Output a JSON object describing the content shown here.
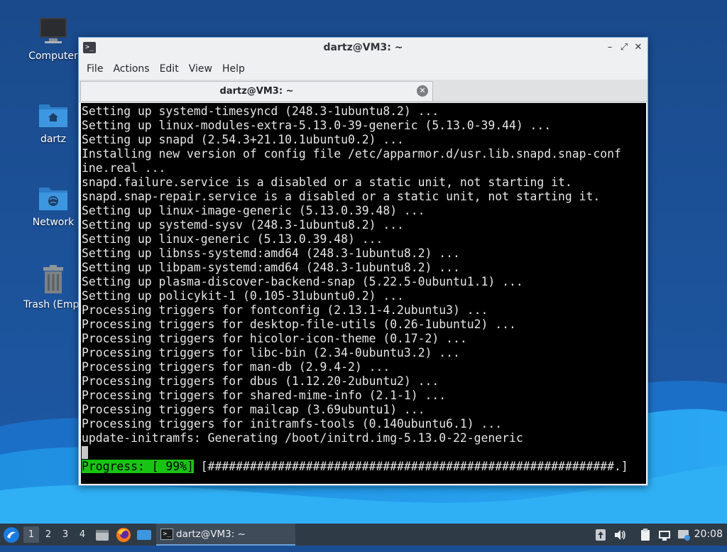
{
  "desktop": {
    "icons": [
      {
        "label": "Computer",
        "icon": "computer-icon"
      },
      {
        "label": "dartz",
        "icon": "home-folder-icon"
      },
      {
        "label": "Network",
        "icon": "network-folder-icon"
      },
      {
        "label": "Trash (Empt",
        "icon": "trash-icon"
      }
    ]
  },
  "window": {
    "title": "dartz@VM3: ~",
    "menu": [
      "File",
      "Actions",
      "Edit",
      "View",
      "Help"
    ],
    "tab_label": "dartz@VM3: ~"
  },
  "terminal": {
    "lines": [
      "Setting up systemd-timesyncd (248.3-1ubuntu8.2) ...",
      "Setting up linux-modules-extra-5.13.0-39-generic (5.13.0-39.44) ...",
      "Setting up snapd (2.54.3+21.10.1ubuntu0.2) ...",
      "Installing new version of config file /etc/apparmor.d/usr.lib.snapd.snap-conf",
      "ine.real ...",
      "snapd.failure.service is a disabled or a static unit, not starting it.",
      "snapd.snap-repair.service is a disabled or a static unit, not starting it.",
      "Setting up linux-image-generic (5.13.0.39.48) ...",
      "Setting up systemd-sysv (248.3-1ubuntu8.2) ...",
      "Setting up linux-generic (5.13.0.39.48) ...",
      "Setting up libnss-systemd:amd64 (248.3-1ubuntu8.2) ...",
      "Setting up libpam-systemd:amd64 (248.3-1ubuntu8.2) ...",
      "Setting up plasma-discover-backend-snap (5.22.5-0ubuntu1.1) ...",
      "Setting up policykit-1 (0.105-31ubuntu0.2) ...",
      "Processing triggers for fontconfig (2.13.1-4.2ubuntu3) ...",
      "Processing triggers for desktop-file-utils (0.26-1ubuntu2) ...",
      "Processing triggers for hicolor-icon-theme (0.17-2) ...",
      "Processing triggers for libc-bin (2.34-0ubuntu3.2) ...",
      "Processing triggers for man-db (2.9.4-2) ...",
      "Processing triggers for dbus (1.12.20-2ubuntu2) ...",
      "Processing triggers for shared-mime-info (2.1-1) ...",
      "Processing triggers for mailcap (3.69ubuntu1) ...",
      "Processing triggers for initramfs-tools (0.140ubuntu6.1) ...",
      "update-initramfs: Generating /boot/initrd.img-5.13.0-22-generic"
    ],
    "progress_label": "Progress: [ 99%]",
    "progress_bar": " [##########################################################.]",
    "progress_percent": 99
  },
  "taskbar": {
    "workspaces": [
      "1",
      "2",
      "3",
      "4"
    ],
    "active_workspace": "1",
    "task_label": "dartz@VM3: ~",
    "clock": "20:08"
  },
  "colors": {
    "wallpaper": "#1a4f95",
    "terminal_bg": "#000000",
    "terminal_fg": "#e6e6e6",
    "progress_bg": "#19c313",
    "taskbar_bg": "#2f3a47",
    "window_border": "#6aa3d8"
  }
}
